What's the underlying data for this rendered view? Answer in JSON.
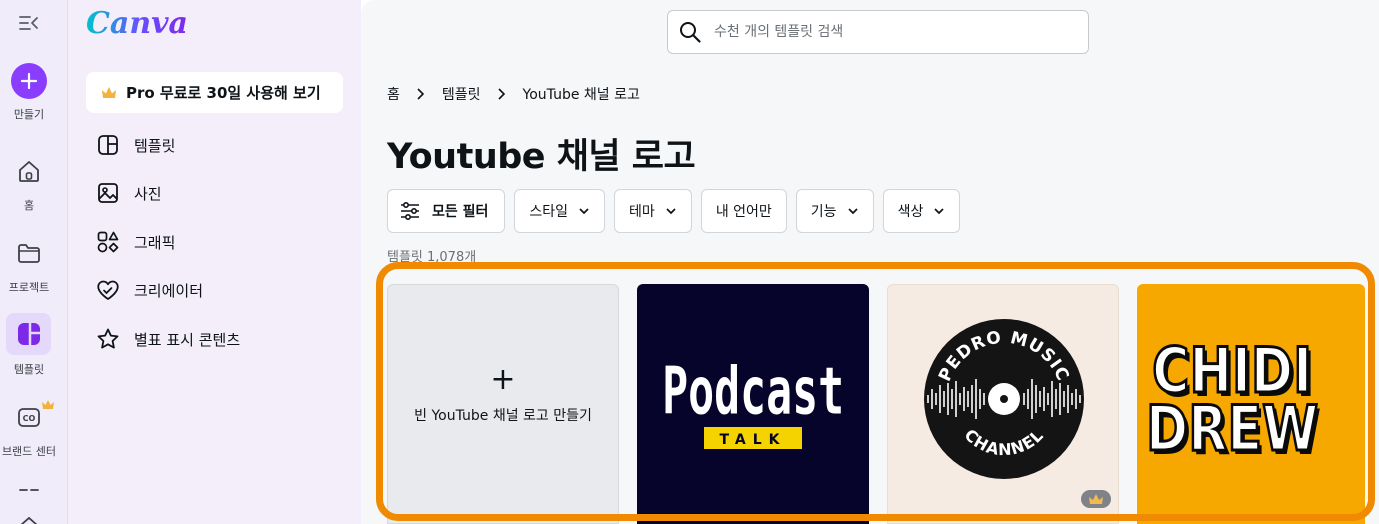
{
  "rail": {
    "create_label": "만들기",
    "home_label": "홈",
    "projects_label": "프로젝트",
    "templates_label": "템플릿",
    "brand_label": "브랜드 센터"
  },
  "panel": {
    "logo": "Canva",
    "pro_label": "Pro 무료로 30일 사용해 보기",
    "items": [
      {
        "label": "템플릿",
        "icon": "template-icon"
      },
      {
        "label": "사진",
        "icon": "photo-icon"
      },
      {
        "label": "그래픽",
        "icon": "graphics-icon"
      },
      {
        "label": "크리에이터",
        "icon": "creator-heart-icon"
      },
      {
        "label": "별표 표시 콘텐츠",
        "icon": "star-icon"
      }
    ]
  },
  "search": {
    "placeholder": "수천 개의 템플릿 검색"
  },
  "breadcrumb": [
    "홈",
    "템플릿",
    "YouTube 채널 로고"
  ],
  "page_title": "Youtube 채널 로고",
  "filters": {
    "all": "모든 필터",
    "style": "스타일",
    "theme": "테마",
    "my_language": "내 언어만",
    "feature": "기능",
    "color": "색상"
  },
  "template_count": "템플릿 1,078개",
  "cards": {
    "blank_label": "빈 YouTube 채널 로고 만들기",
    "podcast": {
      "line1": "Podcast",
      "line2": "TALK"
    },
    "pedro": {
      "top": "PEDRO MUSIC",
      "bottom": "CHANNEL"
    },
    "chidi": {
      "line1": "CHIDI",
      "line2": "DREW"
    }
  },
  "colors": {
    "accent": "#8b3dff",
    "highlight": "#f08a00",
    "podcast_bg": "#06042a",
    "podcast_yellow": "#f5d300",
    "chidi_bg": "#f6a800"
  }
}
